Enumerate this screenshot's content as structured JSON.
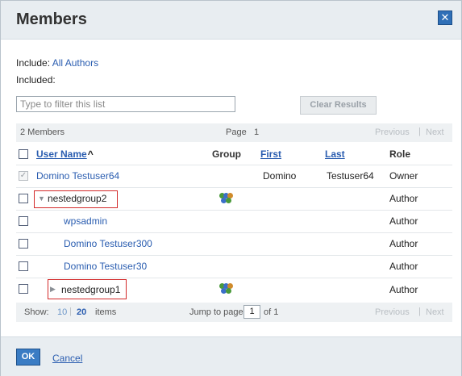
{
  "dialog": {
    "title": "Members",
    "close_glyph": "✕",
    "close_icon": "close-icon"
  },
  "include": {
    "label": "Include:",
    "value": "All Authors"
  },
  "included": {
    "label": "Included:"
  },
  "filter": {
    "placeholder": "Type to filter this list",
    "value": ""
  },
  "clear_button": {
    "label": "Clear Results"
  },
  "pager_top": {
    "count": "2 Members",
    "page_label": "Page",
    "page_number": "1",
    "previous": "Previous",
    "separator": "|",
    "next": "Next"
  },
  "columns": {
    "user_name": "User Name",
    "sort_glyph": "^",
    "group": "Group",
    "first": "First",
    "last": "Last",
    "role": "Role"
  },
  "rows": [
    {
      "name": "Domino Testuser64",
      "first": "Domino",
      "last": "Testuser64",
      "role": "Owner",
      "checked": true
    },
    {
      "name": "nestedgroup2",
      "expander": "▼",
      "group_icon": "group-icon",
      "role": "Author"
    },
    {
      "name": "wpsadmin",
      "role": "Author"
    },
    {
      "name": "Domino Testuser300",
      "role": "Author"
    },
    {
      "name": "Domino Testuser30",
      "role": "Author"
    },
    {
      "name": "nestedgroup1",
      "expander": "▶",
      "group_icon": "group-icon",
      "role": "Author"
    }
  ],
  "pager_bottom": {
    "show_label": "Show:",
    "size_10": "10",
    "separator": "|",
    "size_20": "20",
    "items_label": "items",
    "jump_label": "Jump to page",
    "jump_value": "1",
    "of_label": "of 1",
    "previous": "Previous",
    "next": "Next"
  },
  "footer": {
    "ok": "OK",
    "cancel": "Cancel"
  },
  "colors": {
    "link": "#2a5db0",
    "highlight_box": "#d32a2a",
    "header_bg": "#e8edf1"
  }
}
